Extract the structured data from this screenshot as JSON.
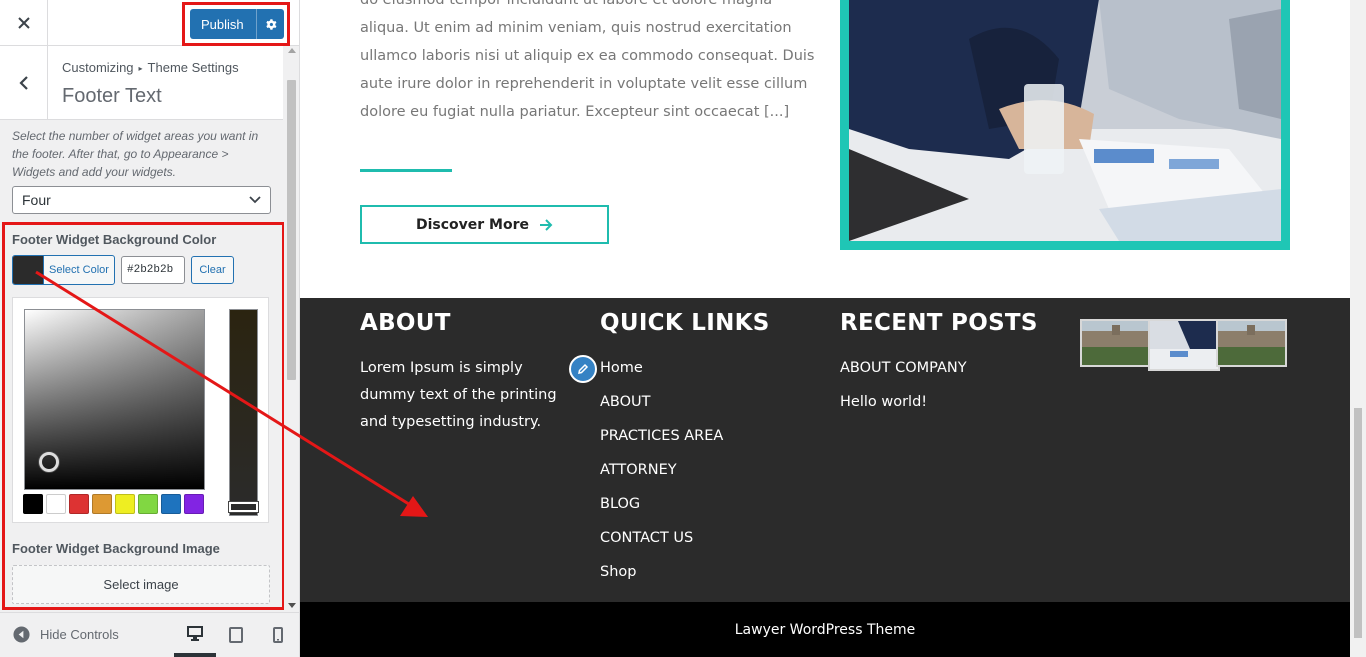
{
  "customizer": {
    "publish_label": "Publish",
    "breadcrumb_root": "Customizing",
    "breadcrumb_section": "Theme Settings",
    "section_title": "Footer Text",
    "description": "Select the number of widget areas you want in the footer. After that, go to Appearance > Widgets and add your widgets.",
    "widget_count_value": "Four",
    "bg_color_label": "Footer Widget Background Color",
    "select_color_label": "Select Color",
    "hex_value": "#2b2b2b",
    "clear_label": "Clear",
    "palette_colors": [
      "#000000",
      "#ffffff",
      "#dd3333",
      "#dd9933",
      "#eeee22",
      "#81d742",
      "#1e73be",
      "#8224e3"
    ],
    "bg_image_label": "Footer Widget Background Image",
    "select_image_label": "Select image",
    "hide_controls_label": "Hide Controls",
    "devices": [
      "desktop-icon",
      "tablet-icon",
      "mobile-icon"
    ]
  },
  "preview": {
    "excerpt": "do eiusmod tempor incididunt ut labore et dolore magna aliqua. Ut enim ad minim veniam, quis nostrud exercitation ullamco laboris nisi ut aliquip ex ea commodo consequat. Duis aute irure dolor in reprehenderit in voluptate velit esse cillum dolore eu fugiat nulla pariatur. Excepteur sint occaecat [...]",
    "discover_label": "Discover More",
    "accent_color": "#1fbcae",
    "footer_bg": "#2b2b2b",
    "about_title": "ABOUT",
    "about_text": "Lorem Ipsum is simply dummy text of the printing and typesetting industry.",
    "quick_links_title": "QUICK LINKS",
    "quick_links": [
      "Home",
      "ABOUT",
      "PRACTICES AREA",
      "ATTORNEY",
      "BLOG",
      "CONTACT US",
      "Shop"
    ],
    "recent_posts_title": "RECENT POSTS",
    "recent_posts": [
      "ABOUT COMPANY",
      "Hello world!"
    ],
    "copyright": "Lawyer WordPress Theme"
  }
}
